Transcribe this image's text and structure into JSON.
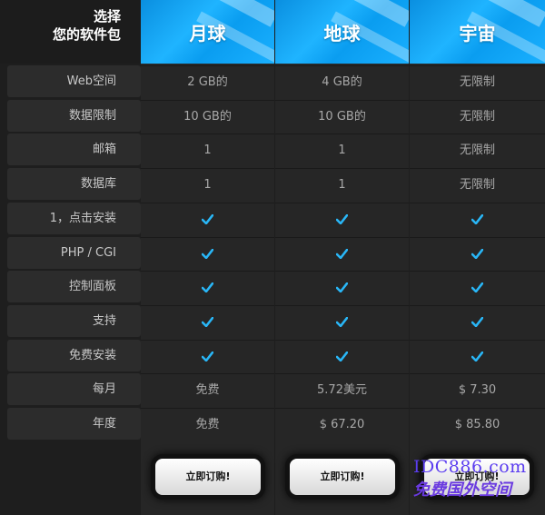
{
  "header": {
    "choose_line1": "选择",
    "choose_line2": "您的软件包",
    "plans": [
      "月球",
      "地球",
      "宇宙"
    ]
  },
  "rows": [
    {
      "label": "Web空间",
      "values": [
        "2 GB的",
        "4 GB的",
        "无限制"
      ]
    },
    {
      "label": "数据限制",
      "values": [
        "10 GB的",
        "10 GB的",
        "无限制"
      ]
    },
    {
      "label": "邮箱",
      "values": [
        "1",
        "1",
        "无限制"
      ]
    },
    {
      "label": "数据库",
      "values": [
        "1",
        "1",
        "无限制"
      ]
    },
    {
      "label": "1，点击安装",
      "values": [
        "check",
        "check",
        "check"
      ]
    },
    {
      "label": "PHP / CGI",
      "values": [
        "check",
        "check",
        "check"
      ]
    },
    {
      "label": "控制面板",
      "values": [
        "check",
        "check",
        "check"
      ]
    },
    {
      "label": "支持",
      "values": [
        "check",
        "check",
        "check"
      ]
    },
    {
      "label": "免费安装",
      "values": [
        "check",
        "check",
        "check"
      ]
    },
    {
      "label": "每月",
      "values": [
        "免费",
        "5.72美元",
        "$ 7.30"
      ]
    },
    {
      "label": "年度",
      "values": [
        "免费",
        "$ 67.20",
        "$ 85.80"
      ]
    }
  ],
  "buttons": [
    "立即订购!",
    "立即订购!",
    "立即订购!"
  ],
  "watermark": {
    "line1": "IDC886.com",
    "line2": "免费国外空间"
  },
  "colors": {
    "accent": "#1aa8f5",
    "check": "#29b6f6",
    "background": "#1e1e1e"
  },
  "icons": {
    "check": "check-icon"
  }
}
